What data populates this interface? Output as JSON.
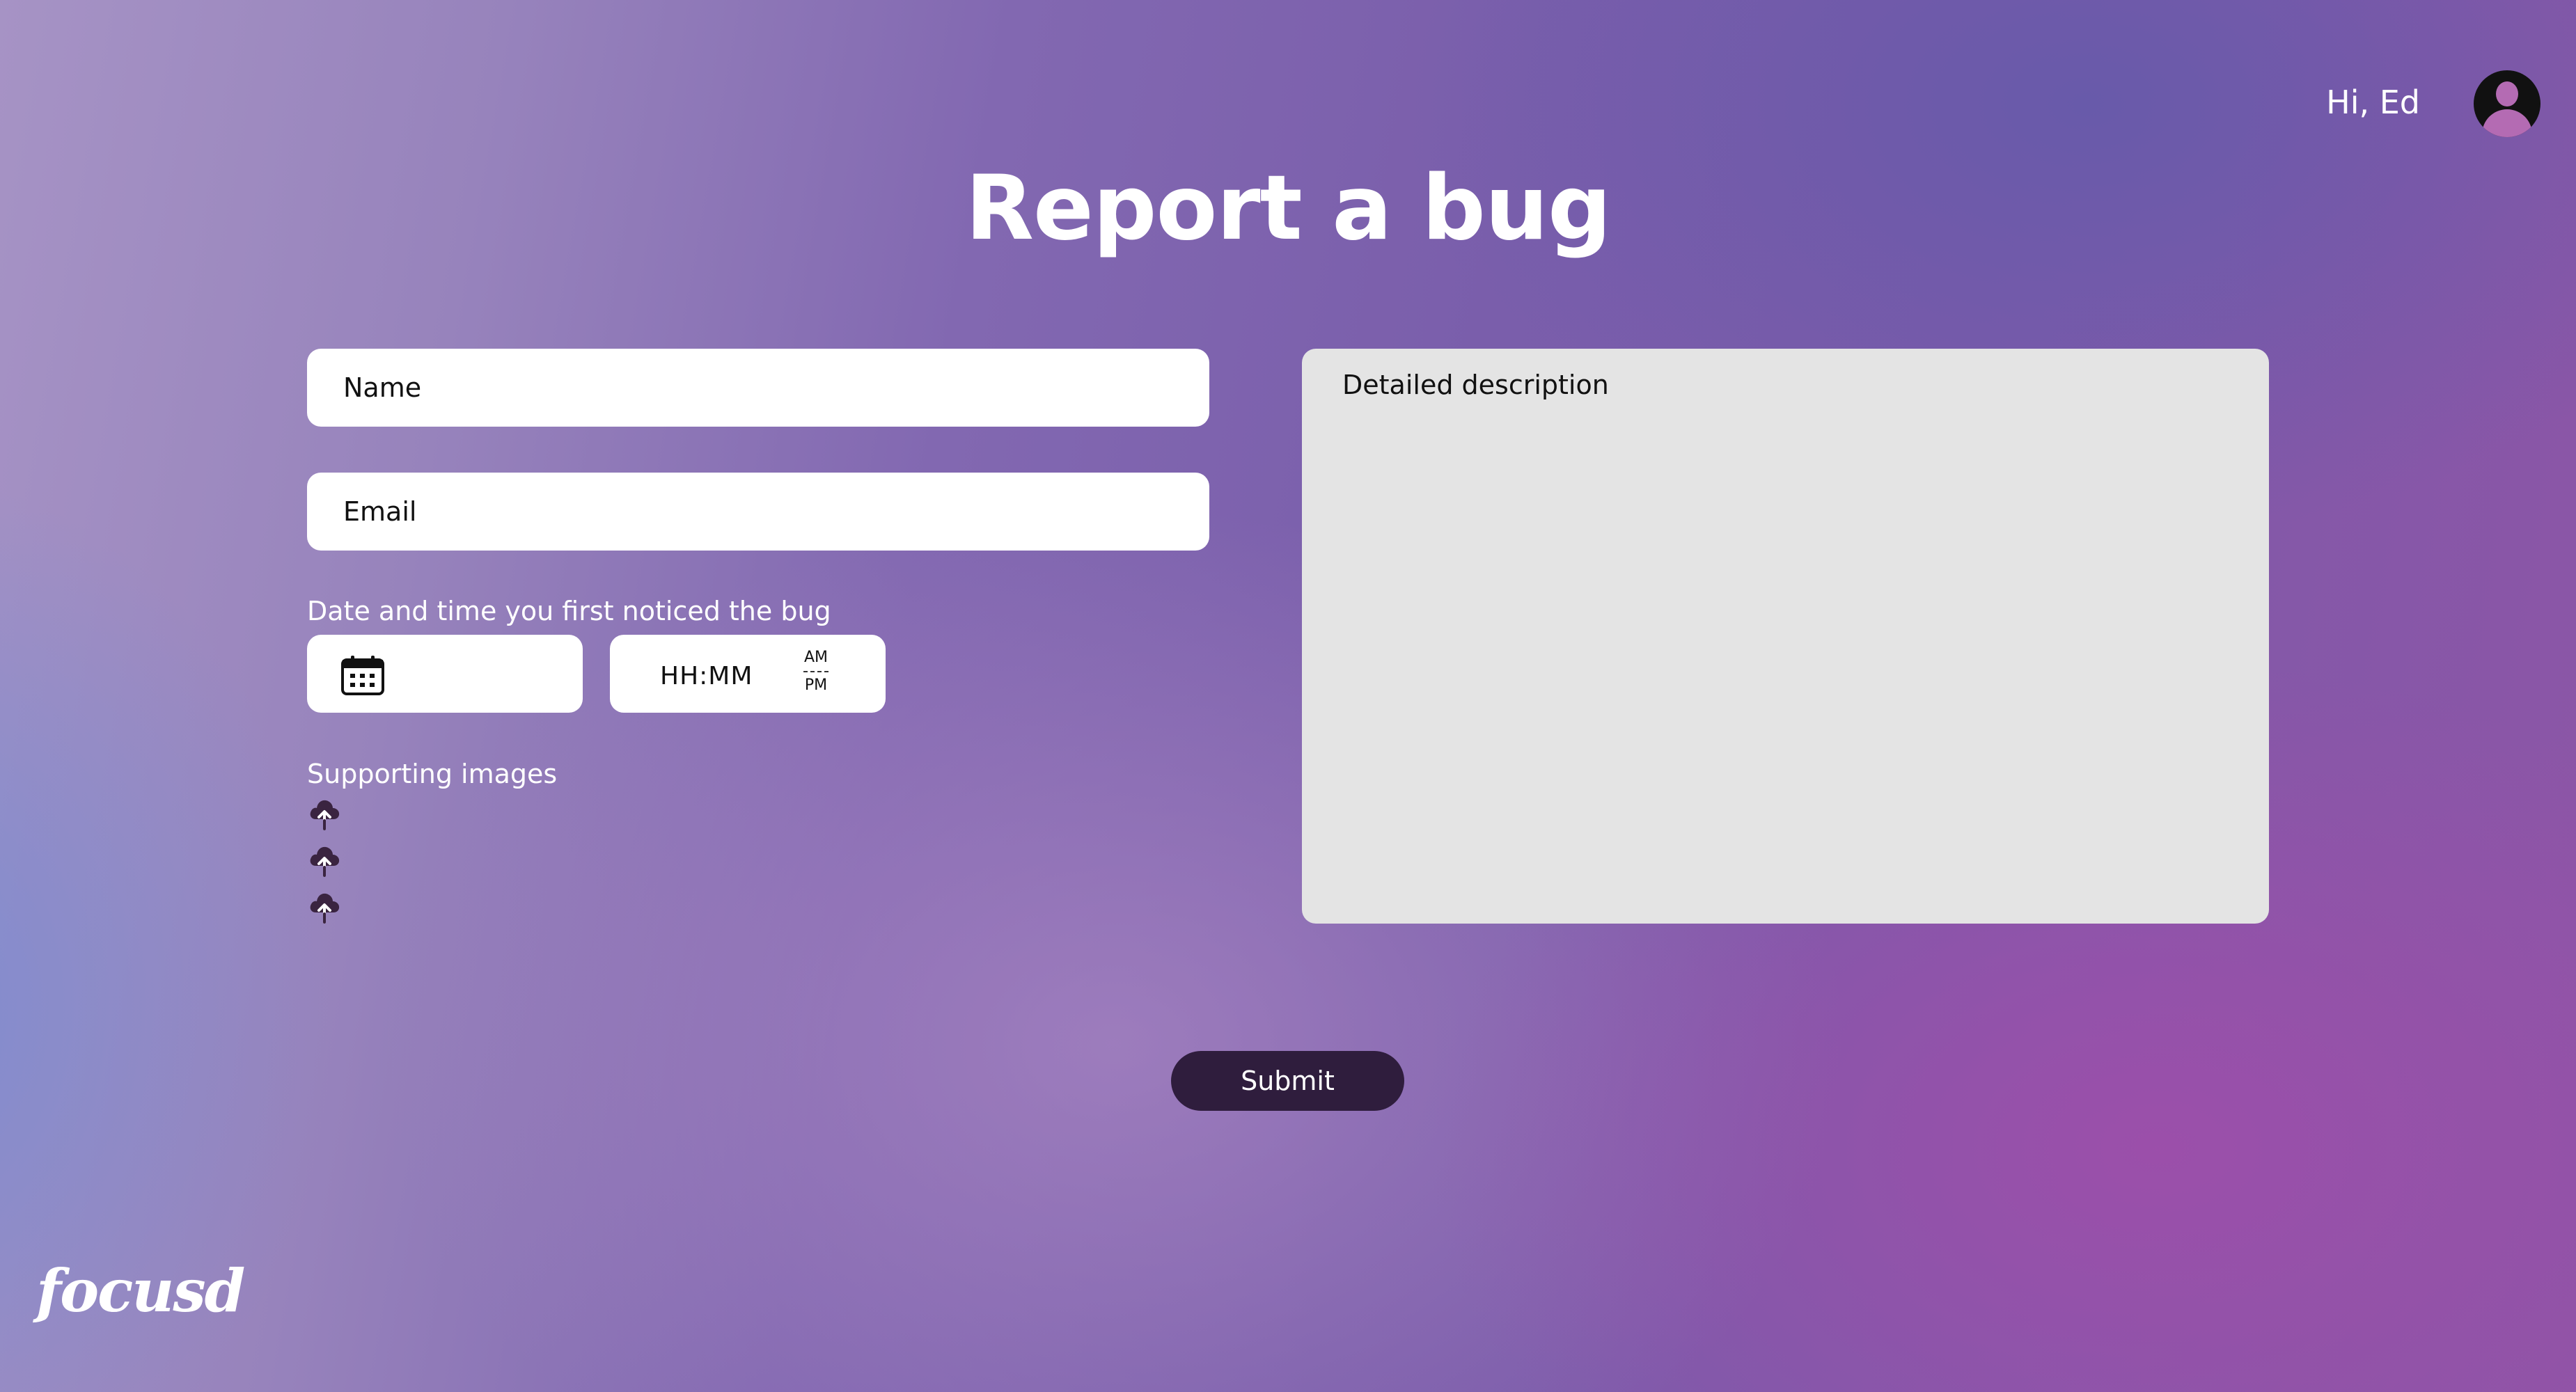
{
  "header": {
    "greeting": "Hi, Ed",
    "avatar_icon": "user-avatar-icon"
  },
  "page": {
    "title": "Report a bug"
  },
  "form": {
    "name_placeholder": "Name",
    "email_placeholder": "Email",
    "datetime_label": "Date and time you first noticed the bug",
    "date_icon": "calendar-icon",
    "time_placeholder": "HH:MM",
    "am_label": "AM",
    "pm_label": "PM",
    "images_label": "Supporting images",
    "upload_icon": "cloud-upload-icon",
    "description_placeholder": "Detailed description",
    "submit_label": "Submit"
  },
  "brand": {
    "logo_text": "focusd"
  },
  "colors": {
    "submit_bg": "#2f1d3d",
    "field_bg": "#ffffff",
    "description_bg": "#e4e4e4",
    "icon_color": "#3a2440"
  }
}
